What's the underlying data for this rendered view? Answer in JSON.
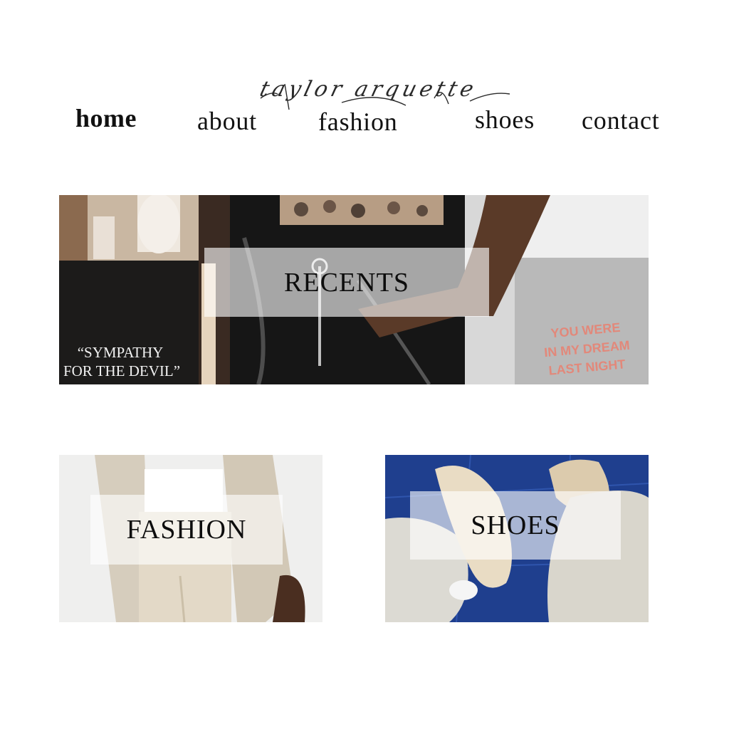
{
  "brand": {
    "name": "taylor arquette"
  },
  "nav": {
    "home": "home",
    "about": "about",
    "fashion": "fashion",
    "shoes": "shoes",
    "contact": "contact"
  },
  "tiles": {
    "recents": {
      "label": "RECENTS",
      "poster_text_line1": "“SYMPATHY",
      "poster_text_line2": "FOR THE DEVIL”",
      "print_text_line1": "YOU WERE",
      "print_text_line2": "IN MY DREAM",
      "print_text_line3": "LAST NIGHT"
    },
    "fashion": {
      "label": "FASHION"
    },
    "shoes": {
      "label": "SHOES"
    }
  },
  "colors": {
    "background": "#ffffff",
    "label_overlay": "rgba(255,255,255,0.62)",
    "text": "#111111",
    "shoes_floor": "#1f3f8e"
  }
}
